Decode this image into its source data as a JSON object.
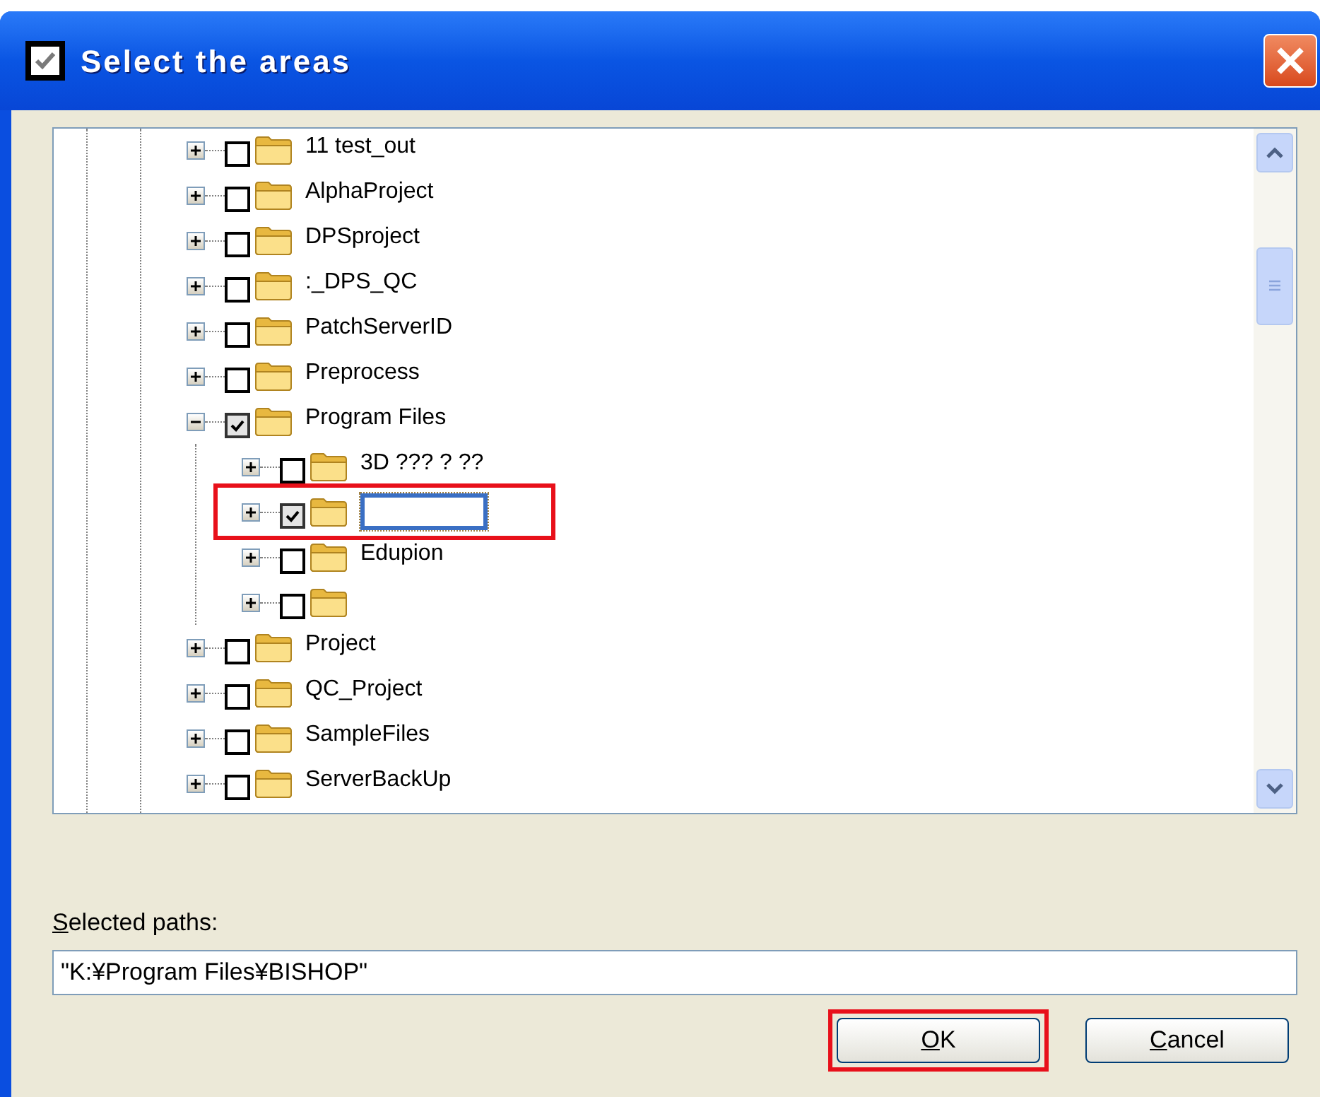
{
  "window": {
    "title": "Select the areas"
  },
  "tree": [
    {
      "label": "11 test_out",
      "expanded": false,
      "checked": false,
      "editing": false,
      "highlighted": false
    },
    {
      "label": "AlphaProject",
      "expanded": false,
      "checked": false,
      "editing": false,
      "highlighted": false
    },
    {
      "label": "DPSproject",
      "expanded": false,
      "checked": false,
      "editing": false,
      "highlighted": false
    },
    {
      "label": ":_DPS_QC",
      "expanded": false,
      "checked": false,
      "editing": false,
      "highlighted": false
    },
    {
      "label": "PatchServerID",
      "expanded": false,
      "checked": false,
      "editing": false,
      "highlighted": false
    },
    {
      "label": "Preprocess",
      "expanded": false,
      "checked": false,
      "editing": false,
      "highlighted": false
    },
    {
      "label": "Program Files",
      "expanded": true,
      "checked": true,
      "editing": false,
      "highlighted": false,
      "children": [
        {
          "label": "3D ??? ? ??",
          "expanded": false,
          "checked": false,
          "editing": false,
          "highlighted": false
        },
        {
          "expanded": false,
          "checked": true,
          "editing": true,
          "highlighted": true
        },
        {
          "label": "Edupion",
          "expanded": false,
          "checked": false,
          "editing": false,
          "highlighted": false
        },
        {
          "expanded": false,
          "checked": false,
          "editing": false,
          "highlighted": false
        }
      ]
    },
    {
      "label": "Project",
      "expanded": false,
      "checked": false,
      "editing": false,
      "highlighted": false
    },
    {
      "label": "QC_Project",
      "expanded": false,
      "checked": false,
      "editing": false,
      "highlighted": false
    },
    {
      "label": "SampleFiles",
      "expanded": false,
      "checked": false,
      "editing": false,
      "highlighted": false
    },
    {
      "label": "ServerBackUp",
      "expanded": false,
      "checked": false,
      "editing": false,
      "highlighted": false
    }
  ],
  "selected_paths": {
    "label": "Selected paths:",
    "value": "\"K:¥Program Files¥BISHOP\""
  },
  "buttons": [
    {
      "label": "OK",
      "highlighted": true
    },
    {
      "label": "Cancel",
      "highlighted": false
    }
  ]
}
